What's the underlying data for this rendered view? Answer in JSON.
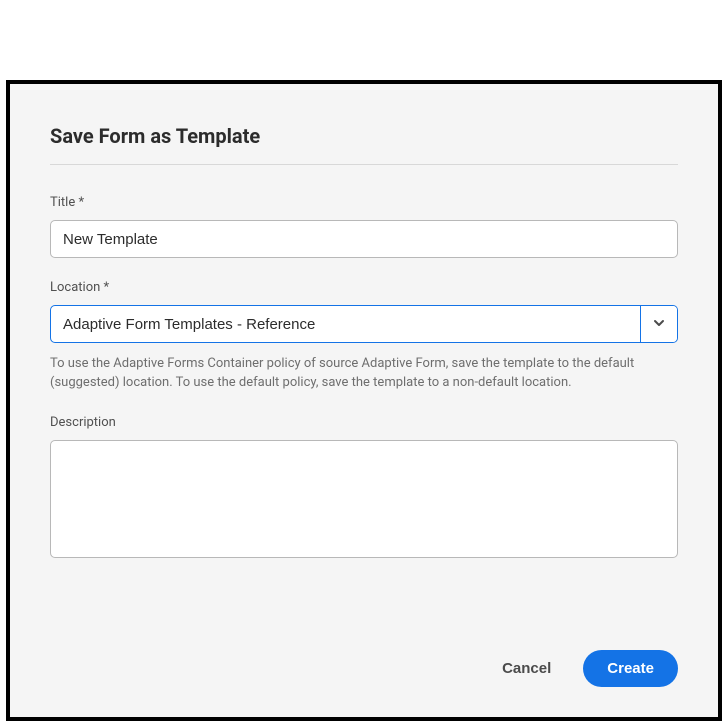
{
  "dialog": {
    "title": "Save Form as Template"
  },
  "fields": {
    "title": {
      "label": "Title *",
      "value": "New Template"
    },
    "location": {
      "label": "Location *",
      "value": "Adaptive Form Templates - Reference",
      "helper": "To use the Adaptive Forms Container policy of source Adaptive Form, save the template to the default (suggested) location. To use the default policy, save the template to a non-default location."
    },
    "description": {
      "label": "Description",
      "value": ""
    }
  },
  "buttons": {
    "cancel": "Cancel",
    "create": "Create"
  }
}
